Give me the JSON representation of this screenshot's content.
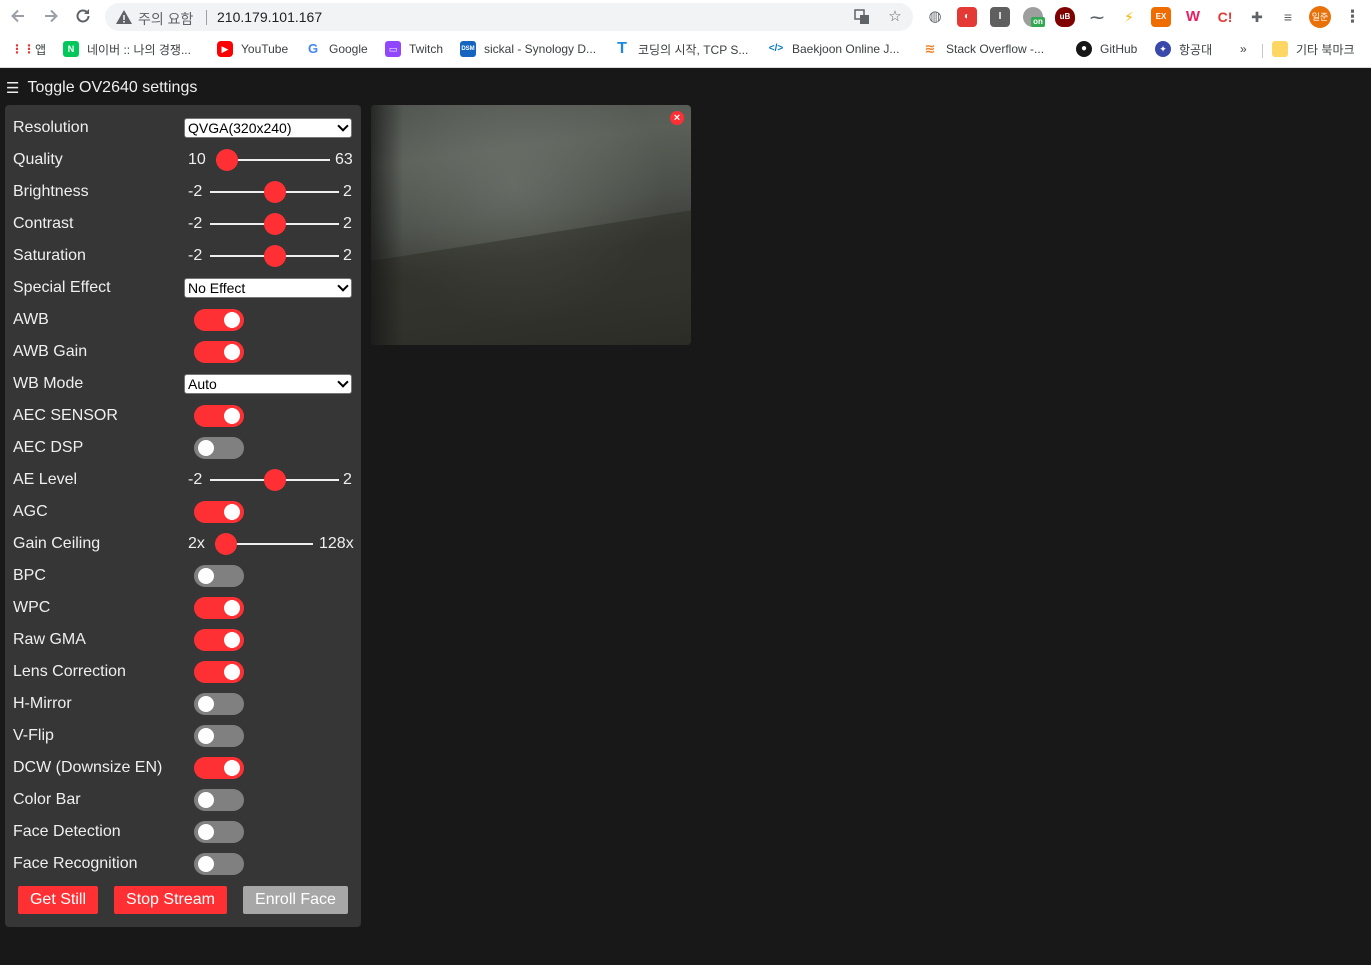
{
  "browser": {
    "omnibox": {
      "status": "주의 요함",
      "url": "210.179.101.167"
    },
    "bookmarks": [
      {
        "label": "앱"
      },
      {
        "label": "네이버 :: 나의 경쟁..."
      },
      {
        "label": "YouTube"
      },
      {
        "label": "Google"
      },
      {
        "label": "Twitch"
      },
      {
        "label": "sickal - Synology D..."
      },
      {
        "label": "코딩의 시작, TCP S..."
      },
      {
        "label": "Baekjoon Online J..."
      },
      {
        "label": "Stack Overflow -..."
      },
      {
        "label": "GitHub"
      },
      {
        "label": "항공대"
      },
      {
        "label": "»"
      },
      {
        "label": "기타 북마크"
      }
    ],
    "profile_initials": "일준",
    "ext_labels": {
      "ub": "uB",
      "ex": "EX",
      "w": "W",
      "ci": "C!",
      "on": "on"
    }
  },
  "page": {
    "toggle_icon": "☰",
    "toggle_label": "Toggle OV2640 settings",
    "settings": {
      "resolution": {
        "label": "Resolution",
        "value": "QVGA(320x240)"
      },
      "quality": {
        "label": "Quality",
        "min": "10",
        "max": "63",
        "value": 10
      },
      "brightness": {
        "label": "Brightness",
        "min": "-2",
        "max": "2",
        "value": 0
      },
      "contrast": {
        "label": "Contrast",
        "min": "-2",
        "max": "2",
        "value": 0
      },
      "saturation": {
        "label": "Saturation",
        "min": "-2",
        "max": "2",
        "value": 0
      },
      "special_effect": {
        "label": "Special Effect",
        "value": "No Effect"
      },
      "awb": {
        "label": "AWB",
        "on": true
      },
      "awb_gain": {
        "label": "AWB Gain",
        "on": true
      },
      "wb_mode": {
        "label": "WB Mode",
        "value": "Auto"
      },
      "aec_sensor": {
        "label": "AEC SENSOR",
        "on": true
      },
      "aec_dsp": {
        "label": "AEC DSP",
        "on": false
      },
      "ae_level": {
        "label": "AE Level",
        "min": "-2",
        "max": "2",
        "value": 0
      },
      "agc": {
        "label": "AGC",
        "on": true
      },
      "gain_ceiling": {
        "label": "Gain Ceiling",
        "min": "2x",
        "max": "128x",
        "value": 0
      },
      "bpc": {
        "label": "BPC",
        "on": false
      },
      "wpc": {
        "label": "WPC",
        "on": true
      },
      "raw_gma": {
        "label": "Raw GMA",
        "on": true
      },
      "lens_correction": {
        "label": "Lens Correction",
        "on": true
      },
      "h_mirror": {
        "label": "H-Mirror",
        "on": false
      },
      "v_flip": {
        "label": "V-Flip",
        "on": false
      },
      "dcw": {
        "label": "DCW (Downsize EN)",
        "on": true
      },
      "color_bar": {
        "label": "Color Bar",
        "on": false
      },
      "face_detection": {
        "label": "Face Detection",
        "on": false
      },
      "face_recognition": {
        "label": "Face Recognition",
        "on": false
      }
    },
    "buttons": {
      "get_still": "Get Still",
      "stop_stream": "Stop Stream",
      "enroll_face": "Enroll Face"
    },
    "close_icon": "×",
    "accent_color": "#ff3034",
    "panel_color": "#363636",
    "background_color": "#181818"
  }
}
